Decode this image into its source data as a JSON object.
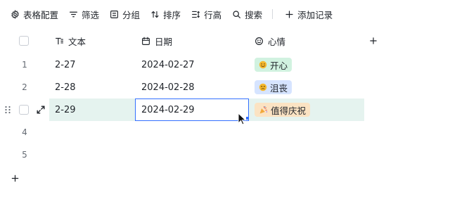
{
  "toolbar": {
    "items": [
      {
        "label": "表格配置",
        "icon": "gear-icon"
      },
      {
        "label": "筛选",
        "icon": "filter-icon"
      },
      {
        "label": "分组",
        "icon": "group-icon"
      },
      {
        "label": "排序",
        "icon": "sort-icon"
      },
      {
        "label": "行高",
        "icon": "row-height-icon"
      },
      {
        "label": "搜索",
        "icon": "search-icon"
      }
    ],
    "add_record": {
      "label": "添加记录",
      "icon": "plus-icon"
    }
  },
  "columns": [
    {
      "label": "文本",
      "icon": "text-field-icon"
    },
    {
      "label": "日期",
      "icon": "calendar-icon"
    },
    {
      "label": "心情",
      "icon": "smile-icon"
    }
  ],
  "rows": [
    {
      "num": "1",
      "text": "2-27",
      "date": "2024-02-27",
      "mood": {
        "label": "开心",
        "emoji": "happy-face-emoji"
      }
    },
    {
      "num": "2",
      "text": "2-28",
      "date": "2024-02-28",
      "mood": {
        "label": "沮丧",
        "emoji": "sad-face-emoji"
      }
    },
    {
      "num": "",
      "text": "2-29",
      "date": "2024-02-29",
      "mood": {
        "label": "值得庆祝",
        "emoji": "party-popper-emoji"
      }
    },
    {
      "num": "4",
      "text": "",
      "date": "",
      "mood": null
    },
    {
      "num": "5",
      "text": "",
      "date": "",
      "mood": null
    }
  ],
  "colors": {
    "accent": "#3370ff",
    "active_row": "#e5f3ef",
    "tag_green": "#d1f2e0",
    "tag_blue": "#d6e4ff",
    "tag_orange": "#fbe3c3"
  }
}
